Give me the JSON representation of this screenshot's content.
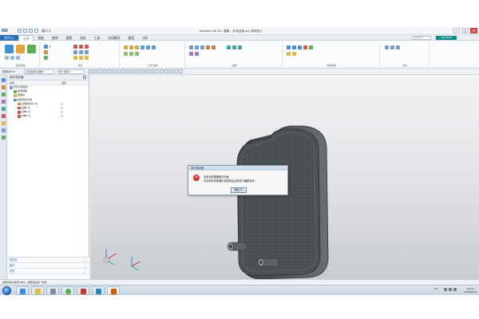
{
  "titlebar": {
    "app_logo": "NX",
    "qat_window": "窗口 ▾",
    "title": "Siemens NX 10 - 建模 - [手机支架.prt (修改的)]",
    "minimize": "–",
    "maximize": "□",
    "close": "✕"
  },
  "ribbon": {
    "tabs": [
      "文件(F)",
      "主页",
      "装配",
      "曲线",
      "视图",
      "渲染",
      "工具",
      "应用模块",
      "曲面",
      "分析"
    ],
    "active_tab_index": 1,
    "search_placeholder": "查找命令",
    "brand": "SIEMENS",
    "groups": [
      "直接草图",
      "特征",
      "同步建模",
      "曲面",
      "编辑特征",
      "更多"
    ]
  },
  "selection_bar": {
    "menu": "菜单(M) ▾",
    "filter_value": "没有选择过滤器 ▾",
    "scope_value": "整个装配 ▾"
  },
  "navigator": {
    "title": "部件导航器",
    "col_name": "名称",
    "col_latest": "最新",
    "tree": [
      {
        "label": "历史记录模式",
        "indent": 0,
        "check": ""
      },
      {
        "label": "模型视图",
        "indent": 1,
        "check": ""
      },
      {
        "label": "摄像机",
        "indent": 1,
        "check": ""
      },
      {
        "label": "模型历史记录",
        "indent": 1,
        "check": ""
      },
      {
        "label": "基准坐标系 (0)",
        "indent": 2,
        "check": "✔"
      },
      {
        "label": "拉伸 (1)",
        "indent": 2,
        "check": "✔"
      },
      {
        "label": "拉伸 (2)",
        "indent": 2,
        "check": "✔"
      },
      {
        "label": "拉伸 (3)",
        "indent": 2,
        "check": "✔"
      }
    ],
    "panels": [
      "相关性",
      "细节",
      "预览"
    ]
  },
  "dialog": {
    "title": "零件导航器",
    "line1": "没有选择要编辑的对象",
    "line2": "请在部件导航器中选择特征后再执行编辑操作。",
    "ok_label": "确定(O)"
  },
  "status": {
    "cue": "选择对象并使用 MB3，或者双击某一对象"
  },
  "taskbar": {
    "ime": "CH",
    "time": "16:22",
    "date": "2016/5/12"
  },
  "colors": {
    "accent": "#2b6cb0",
    "model_body": "#4a4f52",
    "error_icon": "#d22c2c",
    "check": "#2d9b2d"
  }
}
